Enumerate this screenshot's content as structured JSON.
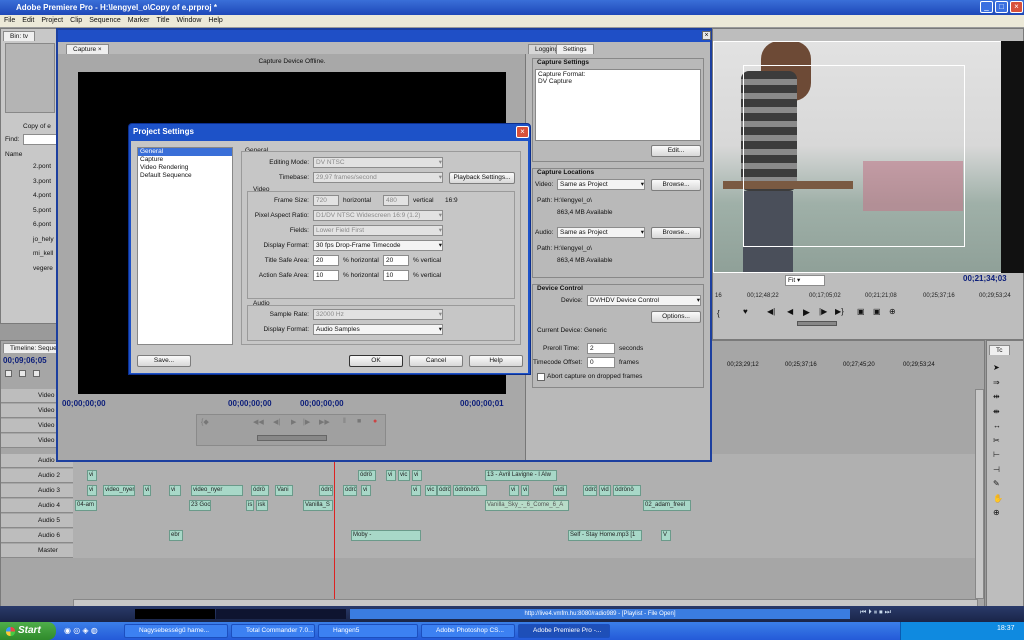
{
  "app": {
    "title": "Adobe Premiere Pro - H:\\lengyel_o\\Copy of  e.prproj *"
  },
  "menu": [
    "File",
    "Edit",
    "Project",
    "Clip",
    "Sequence",
    "Marker",
    "Title",
    "Window",
    "Help"
  ],
  "project_panel": {
    "tab": "Bin: tv",
    "file_label": "Copy of  e",
    "find_label": "Find:",
    "name_header": "Name",
    "items": [
      "2.pont",
      "3.pont",
      "4.pont",
      "5.pont",
      "6.pont",
      "jo_hely",
      "mi_kell",
      "vegere"
    ]
  },
  "capture": {
    "tab": "Capture",
    "status": "Capture Device Offline.",
    "tc_left": "00;00;00;00",
    "tc_in": "00;00;00;00",
    "tc_out": "00;00;00;00",
    "tc_dur": "00;00;00;01",
    "tabs": {
      "logging": "Logging",
      "settings": "Settings"
    },
    "capture_settings_title": "Capture Settings",
    "capture_format_lines": [
      "Capture Format:",
      "DV Capture"
    ],
    "edit_btn": "Edit...",
    "locations_title": "Capture Locations",
    "video_label": "Video:",
    "video_value": "Same as Project",
    "browse1": "Browse...",
    "path1_label": "Path: H:\\lengyel_o\\",
    "avail1": "863,4 MB Available",
    "audio_label": "Audio:",
    "audio_value": "Same as Project",
    "browse2": "Browse...",
    "path2_label": "Path: H:\\lengyel_o\\",
    "avail2": "863,4 MB Available",
    "device_title": "Device Control",
    "device_label": "Device:",
    "device_value": "DV/HDV Device Control",
    "options_btn": "Options...",
    "current_device": "Current Device:  Generic",
    "preroll_label": "Preroll Time:",
    "preroll_value": "2",
    "preroll_unit": "seconds",
    "tc_offset_label": "Timecode Offset:",
    "tc_offset_value": "0",
    "tc_offset_unit": "frames",
    "abort_label": "Abort capture on dropped frames"
  },
  "project_settings": {
    "title": "Project Settings",
    "nav": [
      "General",
      "Capture",
      "Video Rendering",
      "Default Sequence"
    ],
    "general_title": "General",
    "editing_mode_label": "Editing Mode:",
    "editing_mode": "DV NTSC",
    "timebase_label": "Timebase:",
    "timebase": "29,97 frames/second",
    "playback_btn": "Playback Settings...",
    "video_title": "Video",
    "frame_size_label": "Frame Size:",
    "frame_w": "720",
    "horizontal": "horizontal",
    "frame_h": "480",
    "vertical": "vertical",
    "aspect": "16:9",
    "par_label": "Pixel Aspect Ratio:",
    "par": "D1/DV NTSC Widescreen 16:9 (1.2)",
    "fields_label": "Fields:",
    "fields": "Lower Field First",
    "display_format_label": "Display Format:",
    "display_format": "30 fps Drop-Frame Timecode",
    "title_safe_label": "Title Safe Area:",
    "title_safe_h": "20",
    "title_safe_h_unit": "% horizontal",
    "title_safe_v": "20",
    "title_safe_v_unit": "% vertical",
    "action_safe_label": "Action Safe Area:",
    "action_safe_h": "10",
    "action_safe_h_unit": "% horizontal",
    "action_safe_v": "10",
    "action_safe_v_unit": "% vertical",
    "audio_title": "Audio",
    "sample_rate_label": "Sample Rate:",
    "sample_rate": "32000 Hz",
    "audio_display_label": "Display Format:",
    "audio_display": "Audio Samples",
    "save_btn": "Save...",
    "ok_btn": "OK",
    "cancel_btn": "Cancel",
    "help_btn": "Help"
  },
  "program_monitor": {
    "fit": "Fit",
    "timecode": "00;21;34;03",
    "ruler": [
      "00;12;48;22",
      "00;17;05;02",
      "00;21;21;08",
      "00;25;37;16",
      "00;29;53;24"
    ],
    "ruler_left": "16"
  },
  "timeline": {
    "tab": "Timeline: Seque",
    "timecode": "00;09;06;05",
    "ruler": [
      "00;23;29;12",
      "00;25;37;16",
      "00;27;45;20",
      "00;29;53;24"
    ],
    "tracks": [
      "Video",
      "Video",
      "Video",
      "Video",
      "Audio",
      "Audio 2",
      "Audio 3",
      "Audio 4",
      "Audio 5",
      "Audio 6",
      "Master"
    ],
    "clips_a2": [
      "vi",
      "ódrö",
      "vi",
      "vic",
      "vi",
      "13 - Avril Lavigne - I Alw"
    ],
    "clips_a3": [
      "vi",
      "video_nyer",
      "vi",
      "vi",
      "video_nyer",
      "ódrö",
      "Vani",
      "ódrö",
      "ódrö",
      "vi",
      "vi",
      "vic",
      "ódrö",
      "ódrönörö.",
      "vi",
      "vi",
      "vidi",
      "ódrö",
      "vid",
      "ódrönö"
    ],
    "clips_a4": [
      "04-am",
      "23 Goo",
      "is",
      "isk",
      "Vanilla_S",
      "Vanilla_Sky_-_6_Come_6_A",
      "02_adam_freel"
    ],
    "clips_a6": [
      "ebr",
      "Moby -",
      "Self - Stay Home.mp3 [1",
      "V"
    ]
  },
  "tools_tab": "Tc",
  "winamp": {
    "url": "http://live4.vmfm.hu:8080/radio989  -  [Playlist - File Open]"
  },
  "taskbar": {
    "start": "Start",
    "tasks": [
      "Nagysebességű hame...",
      "Total Commander 7.0...",
      "Hangen5",
      "Adobe Photoshop CS...",
      "Adobe Premiere Pro -..."
    ],
    "clock": "18:37"
  }
}
